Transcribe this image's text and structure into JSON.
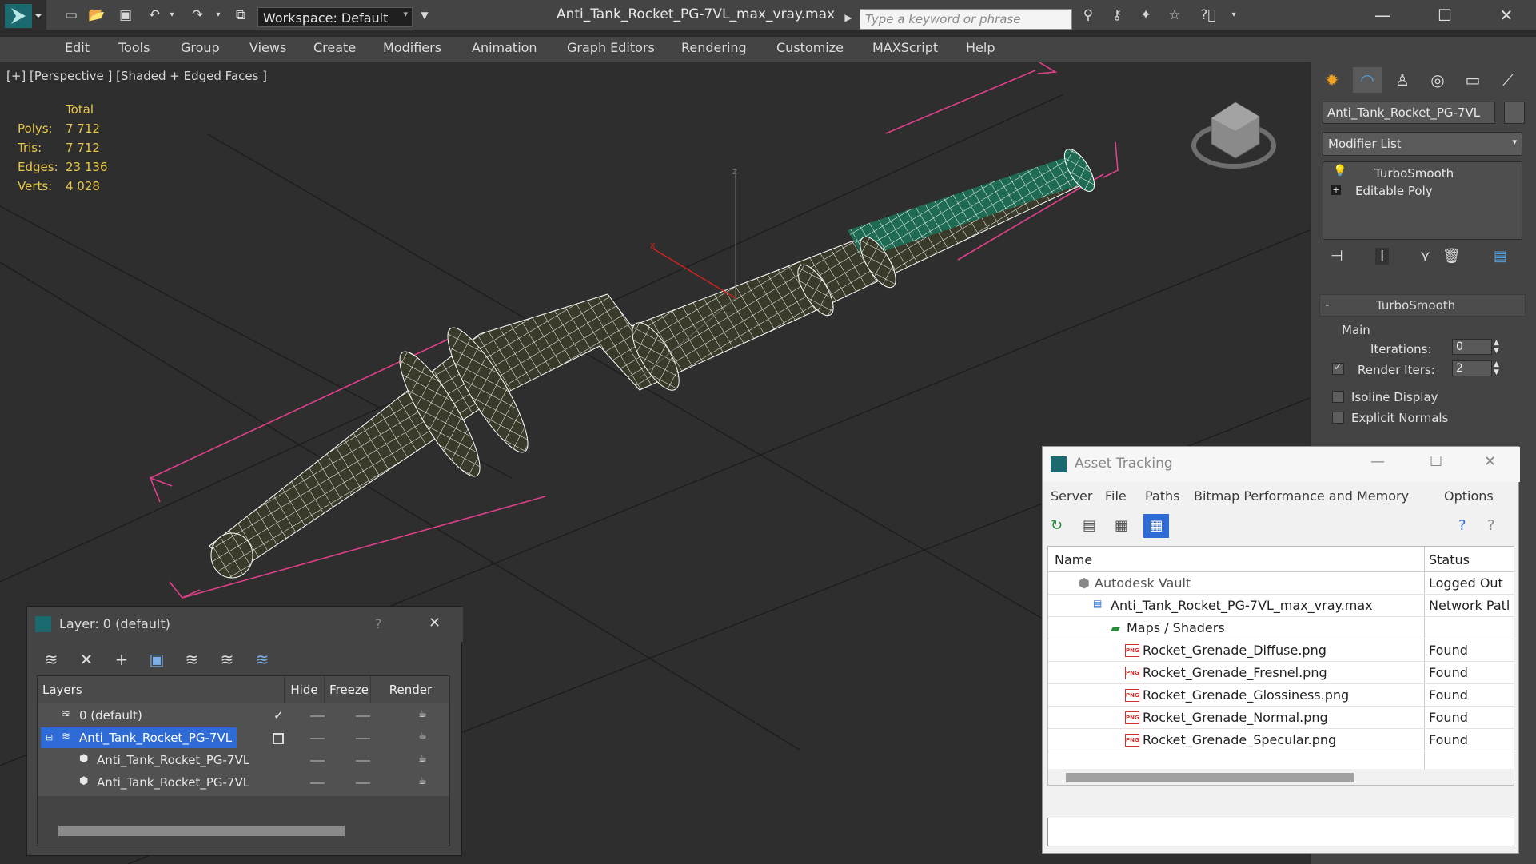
{
  "titlebar": {
    "workspace": "Workspace: Default",
    "file_title": "Anti_Tank_Rocket_PG-7VL_max_vray.max",
    "search_placeholder": "Type a keyword or phrase"
  },
  "menubar": {
    "items": [
      "Edit",
      "Tools",
      "Group",
      "Views",
      "Create",
      "Modifiers",
      "Animation",
      "Graph Editors",
      "Rendering",
      "Customize",
      "MAXScript",
      "Help"
    ]
  },
  "viewport": {
    "label": "[+] [Perspective ] [Shaded + Edged Faces ]",
    "stats": {
      "header": "Total",
      "polys_label": "Polys:",
      "polys": "7 712",
      "tris_label": "Tris:",
      "tris": "7 712",
      "edges_label": "Edges:",
      "edges": "23 136",
      "verts_label": "Verts:",
      "verts": "4 028"
    },
    "gizmo_x": "x",
    "gizmo_z": "z"
  },
  "command_panel": {
    "object_name": "Anti_Tank_Rocket_PG-7VL",
    "modifier_list": "Modifier List",
    "stack": [
      "TurboSmooth",
      "Editable Poly"
    ],
    "rollout_title": "TurboSmooth",
    "group_main": "Main",
    "iterations_label": "Iterations:",
    "iterations": "0",
    "render_iters_label": "Render Iters:",
    "render_iters": "2",
    "isoline": "Isoline Display",
    "explicit_normals": "Explicit Normals"
  },
  "layer_window": {
    "title": "Layer: 0 (default)",
    "help": "?",
    "columns": [
      "Layers",
      "Hide",
      "Freeze",
      "Render"
    ],
    "rows": [
      {
        "name": "0 (default)"
      },
      {
        "name": "Anti_Tank_Rocket_PG-7VL"
      },
      {
        "name": "Anti_Tank_Rocket_PG-7VL"
      },
      {
        "name": "Anti_Tank_Rocket_PG-7VL"
      }
    ]
  },
  "asset_tracking": {
    "title": "Asset Tracking",
    "menu": [
      "Server",
      "File",
      "Paths",
      "Bitmap Performance and Memory",
      "Options"
    ],
    "columns": [
      "Name",
      "Status"
    ],
    "rows": [
      {
        "name": "Autodesk Vault",
        "status": "Logged Out"
      },
      {
        "name": "Anti_Tank_Rocket_PG-7VL_max_vray.max",
        "status": "Network Patl"
      },
      {
        "name": "Maps / Shaders",
        "status": ""
      },
      {
        "name": "Rocket_Grenade_Diffuse.png",
        "status": "Found"
      },
      {
        "name": "Rocket_Grenade_Fresnel.png",
        "status": "Found"
      },
      {
        "name": "Rocket_Grenade_Glossiness.png",
        "status": "Found"
      },
      {
        "name": "Rocket_Grenade_Normal.png",
        "status": "Found"
      },
      {
        "name": "Rocket_Grenade_Specular.png",
        "status": "Found"
      }
    ]
  },
  "colors": {
    "accent_blue": "#2f6bd6",
    "stats_yellow": "#e8c84a",
    "selection_pink": "#e0408a",
    "wire_white": "#ffffff",
    "mesh_green": "#1e6a52"
  }
}
